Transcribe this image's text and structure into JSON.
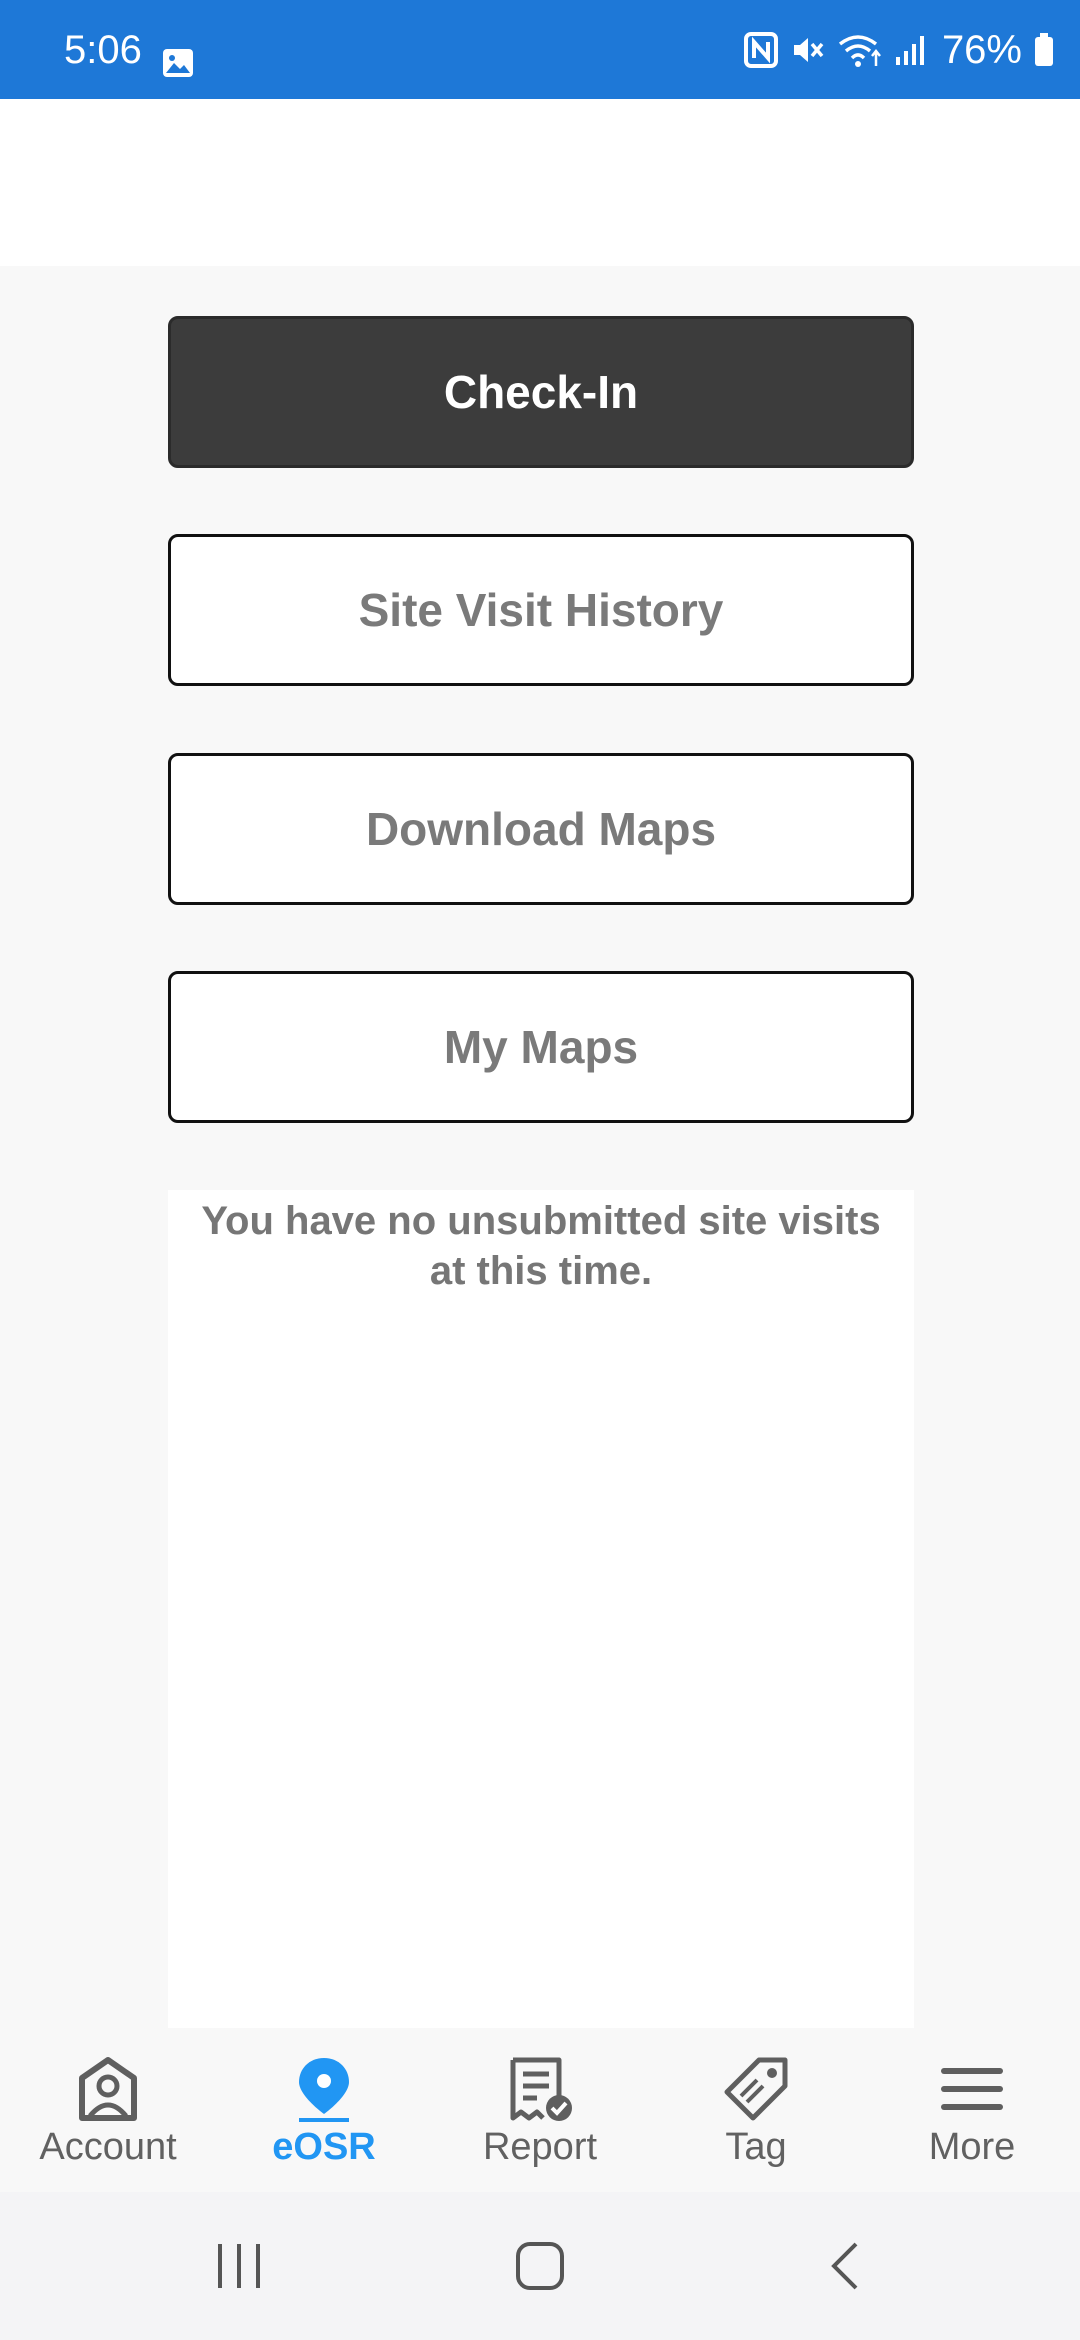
{
  "status_bar": {
    "time": "5:06",
    "battery": "76%",
    "icons": [
      "photo-icon",
      "nfc-icon",
      "mute-icon",
      "wifi-icon",
      "signal-icon",
      "battery-icon"
    ]
  },
  "main": {
    "buttons": {
      "check_in": "Check-In",
      "site_visit_history": "Site Visit History",
      "download_maps": "Download Maps",
      "my_maps": "My Maps"
    },
    "empty_message": "You have no unsubmitted site visits at this time."
  },
  "bottom_nav": {
    "active": "eOSR",
    "items": [
      {
        "label": "Account",
        "icon": "account-icon"
      },
      {
        "label": "eOSR",
        "icon": "location-pin-icon"
      },
      {
        "label": "Report",
        "icon": "report-icon"
      },
      {
        "label": "Tag",
        "icon": "tag-icon"
      },
      {
        "label": "More",
        "icon": "menu-icon"
      }
    ]
  },
  "colors": {
    "status_bar": "#1e78d7",
    "accent": "#2196f3",
    "dark_button": "#3c3c3c"
  }
}
